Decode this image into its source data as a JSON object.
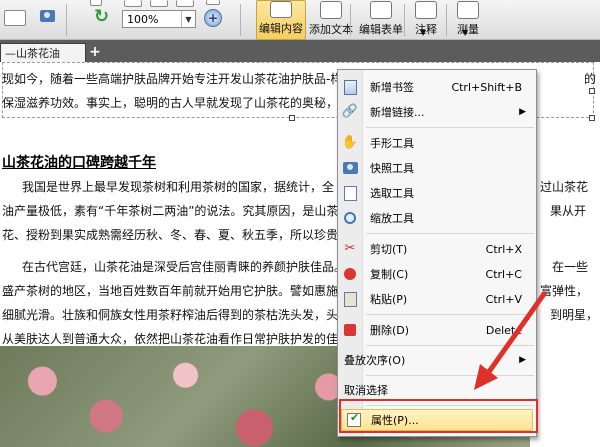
{
  "toolbar": {
    "zoom_value": "100%",
    "buttons": {
      "edit_content": "编辑内容",
      "add_text": "添加文本",
      "edit_form": "编辑表单",
      "annotate": "注释",
      "measure": "测量"
    }
  },
  "tabs": {
    "active_label": "—山茶花油",
    "add_symbol": "+"
  },
  "document": {
    "line1": "现如今，随着一些高端护肤品牌开始专注开发山茶花油护肤品-样",
    "line1_right": "的",
    "line2": "保湿滋养功效。事实上，聪明的古人早就发现了山茶花的奥秘，",
    "heading": "山茶花油的口碑跨越千年",
    "p1_l1": "我国是世界上最早发现茶树和利用茶树的国家，据统计，全",
    "p1_l1_right": "过山茶花",
    "p1_l2": "油产量极低，素有“千年茶树二两油”的说法。究其原因，是山茶",
    "p1_l2_right": "果从开",
    "p1_l3": "花、授粉到果实成熟需经历秋、冬、春、夏、秋五季，所以珍贵",
    "p2_l1": "在古代宫廷，山茶花油是深受后宫佳丽青睐的养颜护肤佳品。",
    "p2_l1_right": "在一些",
    "p2_l2": "盛产茶树的地区，当地百姓数百年前就开始用它护肤。譬如惠施土",
    "p2_l2_right": "富弹性，",
    "p2_l3": "细腻光滑。壮族和侗族女性用茶籽榨油后得到的茶枯洗头发，头发",
    "p2_l3_right": "到明星，",
    "p2_l4": "从美肤达人到普通大众，依然把山茶花油看作日常护肤护发的佳品"
  },
  "context_menu": {
    "items": [
      {
        "label": "新增书签",
        "shortcut": "Ctrl+Shift+B",
        "icon": "bookmark-icon"
      },
      {
        "label": "新增链接...",
        "submenu": "▶",
        "icon": "link-icon"
      },
      {
        "label": "手形工具",
        "icon": "hand-icon"
      },
      {
        "label": "快照工具",
        "icon": "camera-icon"
      },
      {
        "label": "选取工具",
        "icon": "select-icon"
      },
      {
        "label": "缩放工具",
        "icon": "zoom-icon"
      },
      {
        "label": "剪切(T)",
        "shortcut": "Ctrl+X",
        "icon": "scissors-icon"
      },
      {
        "label": "复制(C)",
        "shortcut": "Ctrl+C",
        "icon": "copy-icon"
      },
      {
        "label": "粘贴(P)",
        "shortcut": "Ctrl+V",
        "icon": "paste-icon"
      },
      {
        "label": "删除(D)",
        "shortcut": "Delete",
        "icon": "delete-icon"
      },
      {
        "label": "叠放次序(O)",
        "submenu": "▶"
      },
      {
        "label": "取消选择"
      },
      {
        "label": "属性(P)...",
        "icon": "properties-icon"
      }
    ]
  },
  "colors": {
    "highlight_border": "#e0302a",
    "menu_highlight": "#ffe38e"
  }
}
